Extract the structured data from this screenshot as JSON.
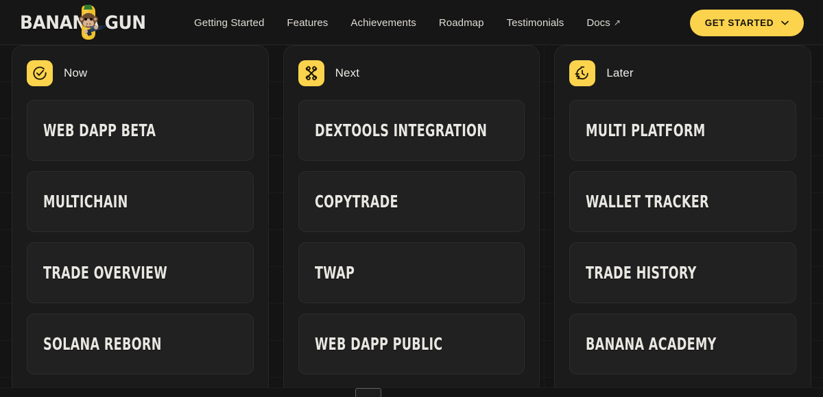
{
  "header": {
    "brand": {
      "wordmark": "BANANA GUN",
      "mark_icon": "banana-monkey-gun-mascot"
    },
    "nav": [
      {
        "label": "Getting Started",
        "external": false
      },
      {
        "label": "Features",
        "external": false
      },
      {
        "label": "Achievements",
        "external": false
      },
      {
        "label": "Roadmap",
        "external": false
      },
      {
        "label": "Testimonials",
        "external": false
      },
      {
        "label": "Docs",
        "external": true,
        "external_glyph": "↗"
      }
    ],
    "cta": {
      "label": "GET STARTED",
      "icon": "chevron-down-icon"
    }
  },
  "roadmap": {
    "columns": [
      {
        "title": "Now",
        "icon": "circle-check-icon",
        "cards": [
          {
            "title": "WEB DAPP BETA"
          },
          {
            "title": "MULTICHAIN"
          },
          {
            "title": "TRADE OVERVIEW"
          },
          {
            "title": "SOLANA REBORN"
          }
        ]
      },
      {
        "title": "Next",
        "icon": "crossed-tools-icon",
        "cards": [
          {
            "title": "DEXTOOLS INTEGRATION"
          },
          {
            "title": "COPYTRADE"
          },
          {
            "title": "TWAP"
          },
          {
            "title": "WEB DAPP PUBLIC"
          }
        ]
      },
      {
        "title": "Later",
        "icon": "stopwatch-icon",
        "cards": [
          {
            "title": "MULTI PLATFORM"
          },
          {
            "title": "WALLET TRACKER"
          },
          {
            "title": "TRADE HISTORY"
          },
          {
            "title": "BANANA ACADEMY"
          }
        ]
      }
    ]
  },
  "colors": {
    "accent": "#fcd34d",
    "page_bg": "#141414",
    "panel_bg": "#1b1b1b",
    "card_bg": "#212121",
    "text": "#e9e7e2"
  }
}
